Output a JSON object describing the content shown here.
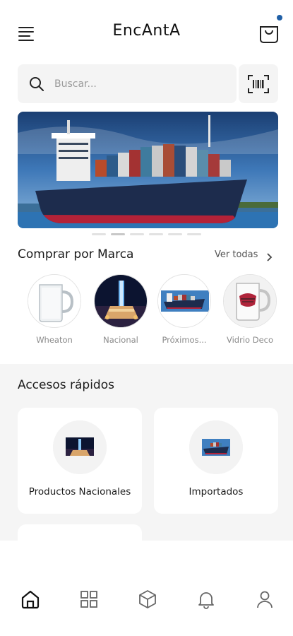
{
  "header": {
    "title": "EncAntA",
    "menu_icon": "menu-icon",
    "cart_icon": "shopping-bag-icon",
    "cart_badge_color": "#1f5fa6"
  },
  "search": {
    "placeholder": "Buscar...",
    "icon": "search-icon",
    "scan_icon": "barcode-scan-icon"
  },
  "banner": {
    "image": "container-ship-photo",
    "slides": 6,
    "active_slide": 2
  },
  "brands": {
    "title": "Comprar por Marca",
    "see_all": "Ver todas",
    "items": [
      {
        "name": "Wheaton",
        "image": "glass-mug-photo"
      },
      {
        "name": "Nacional",
        "image": "monument-night-photo"
      },
      {
        "name": "Próximos...",
        "image": "container-ship-photo"
      },
      {
        "name": "Vidrio Deco",
        "image": "decorated-mug-photo"
      }
    ]
  },
  "quick_access": {
    "title": "Accesos rápidos",
    "items": [
      {
        "label": "Productos Nacionales",
        "image": "monument-night-photo"
      },
      {
        "label": "Importados",
        "image": "container-ship-photo"
      }
    ]
  },
  "bottom_nav": {
    "items": [
      "home-icon",
      "grid-icon",
      "box-icon",
      "bell-icon",
      "user-icon"
    ],
    "active": "home-icon"
  }
}
